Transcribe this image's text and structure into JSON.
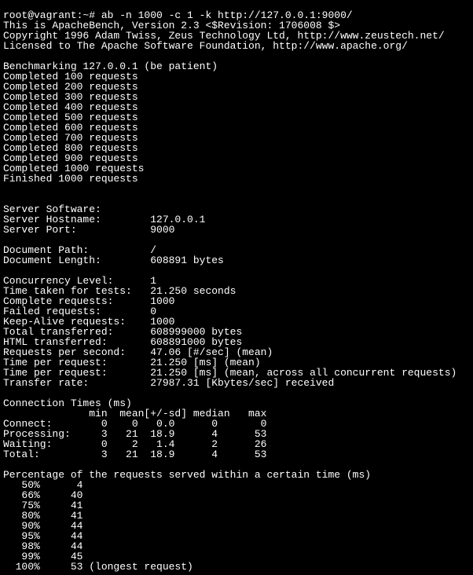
{
  "prompt": "root@vagrant:~# ab -n 1000 -c 1 -k http://127.0.0.1:9000/",
  "intro": [
    "This is ApacheBench, Version 2.3 <$Revision: 1706008 $>",
    "Copyright 1996 Adam Twiss, Zeus Technology Ltd, http://www.zeustech.net/",
    "Licensed to The Apache Software Foundation, http://www.apache.org/"
  ],
  "benchmark_header": "Benchmarking 127.0.0.1 (be patient)",
  "progress": [
    "Completed 100 requests",
    "Completed 200 requests",
    "Completed 300 requests",
    "Completed 400 requests",
    "Completed 500 requests",
    "Completed 600 requests",
    "Completed 700 requests",
    "Completed 800 requests",
    "Completed 900 requests",
    "Completed 1000 requests",
    "Finished 1000 requests"
  ],
  "kv_group1": [
    {
      "k": "Server Software:",
      "v": ""
    },
    {
      "k": "Server Hostname:",
      "v": "127.0.0.1"
    },
    {
      "k": "Server Port:",
      "v": "9000"
    }
  ],
  "kv_group2": [
    {
      "k": "Document Path:",
      "v": "/"
    },
    {
      "k": "Document Length:",
      "v": "608891 bytes"
    }
  ],
  "kv_group3": [
    {
      "k": "Concurrency Level:",
      "v": "1"
    },
    {
      "k": "Time taken for tests:",
      "v": "21.250 seconds"
    },
    {
      "k": "Complete requests:",
      "v": "1000"
    },
    {
      "k": "Failed requests:",
      "v": "0"
    },
    {
      "k": "Keep-Alive requests:",
      "v": "1000"
    },
    {
      "k": "Total transferred:",
      "v": "608999000 bytes"
    },
    {
      "k": "HTML transferred:",
      "v": "608891000 bytes"
    },
    {
      "k": "Requests per second:",
      "v": "47.06 [#/sec] (mean)"
    },
    {
      "k": "Time per request:",
      "v": "21.250 [ms] (mean)"
    },
    {
      "k": "Time per request:",
      "v": "21.250 [ms] (mean, across all concurrent requests)"
    },
    {
      "k": "Transfer rate:",
      "v": "27987.31 [Kbytes/sec] received"
    }
  ],
  "conn_header": "Connection Times (ms)",
  "conn_cols": "              min  mean[+/-sd] median   max",
  "conn_rows": [
    "Connect:        0    0   0.0      0       0",
    "Processing:     3   21  18.9      4      53",
    "Waiting:        0    2   1.4      2      26",
    "Total:          3   21  18.9      4      53"
  ],
  "pct_header": "Percentage of the requests served within a certain time (ms)",
  "pct_rows": [
    {
      "p": "50%",
      "v": "4",
      "suffix": ""
    },
    {
      "p": "66%",
      "v": "40",
      "suffix": ""
    },
    {
      "p": "75%",
      "v": "41",
      "suffix": ""
    },
    {
      "p": "80%",
      "v": "41",
      "suffix": ""
    },
    {
      "p": "90%",
      "v": "44",
      "suffix": ""
    },
    {
      "p": "95%",
      "v": "44",
      "suffix": ""
    },
    {
      "p": "98%",
      "v": "44",
      "suffix": ""
    },
    {
      "p": "99%",
      "v": "45",
      "suffix": ""
    },
    {
      "p": "100%",
      "v": "53",
      "suffix": " (longest request)"
    }
  ]
}
